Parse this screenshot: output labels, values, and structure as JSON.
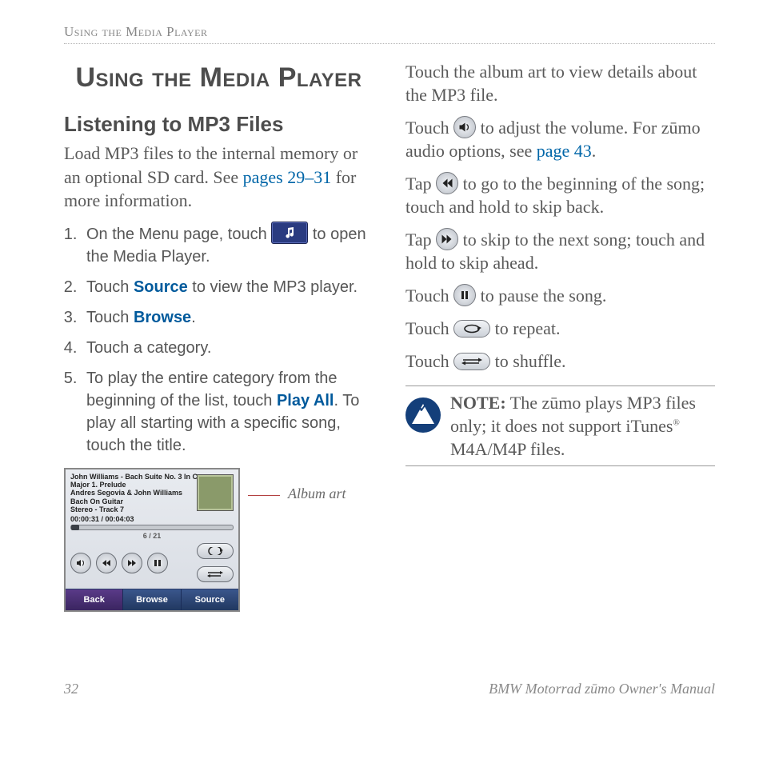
{
  "runningHead": "Using the Media Player",
  "chapterTitle": "Using the Media Player",
  "sectionTitle": "Listening to MP3 Files",
  "intro": {
    "before": "Load MP3 files to the internal memory or an optional SD card. See ",
    "link": "pages 29–31",
    "after": " for more information."
  },
  "steps": {
    "s1a": "On the Menu page, touch ",
    "s1b": " to open the Media Player.",
    "s2a": "Touch ",
    "s2kw": "Source",
    "s2b": " to view the MP3 player.",
    "s3a": "Touch ",
    "s3kw": "Browse",
    "s3b": ".",
    "s4": "Touch a category.",
    "s5a": "To play the entire category from the beginning of the list, touch ",
    "s5kw": "Play All",
    "s5b": ". To play all starting with a specific song, touch the title."
  },
  "screenshot": {
    "line1": "John Williams - Bach Suite No. 3 In C",
    "line2": "Major 1. Prelude",
    "line3": "Andres Segovia & John Williams",
    "line4": "Bach On Guitar",
    "line5": "Stereo - Track 7",
    "time": "00:00:31 / 00:04:03",
    "count": "6 / 21",
    "back": "Back",
    "browse": "Browse",
    "source": "Source"
  },
  "callout": "Album art",
  "right": {
    "p1": "Touch the album art to view details about the MP3 file.",
    "p2a": "Touch ",
    "p2b": " to adjust the volume. For zūmo audio options, see ",
    "p2link": "page 43",
    "p2c": ".",
    "p3a": "Tap ",
    "p3b": " to go to the beginning of the song; touch and hold to skip back.",
    "p4a": "Tap ",
    "p4b": " to skip to the next song; touch and hold to skip ahead.",
    "p5a": "Touch ",
    "p5b": " to pause the song.",
    "p6a": "Touch ",
    "p6b": " to repeat.",
    "p7a": "Touch ",
    "p7b": " to shuffle."
  },
  "note": {
    "label": "NOTE:",
    "text1": " The zūmo plays MP3 files only; it does not support iTunes",
    "reg": "®",
    "text2": "  M4A/M4P files."
  },
  "footer": {
    "page": "32",
    "title": "BMW Motorrad zūmo Owner's Manual"
  }
}
